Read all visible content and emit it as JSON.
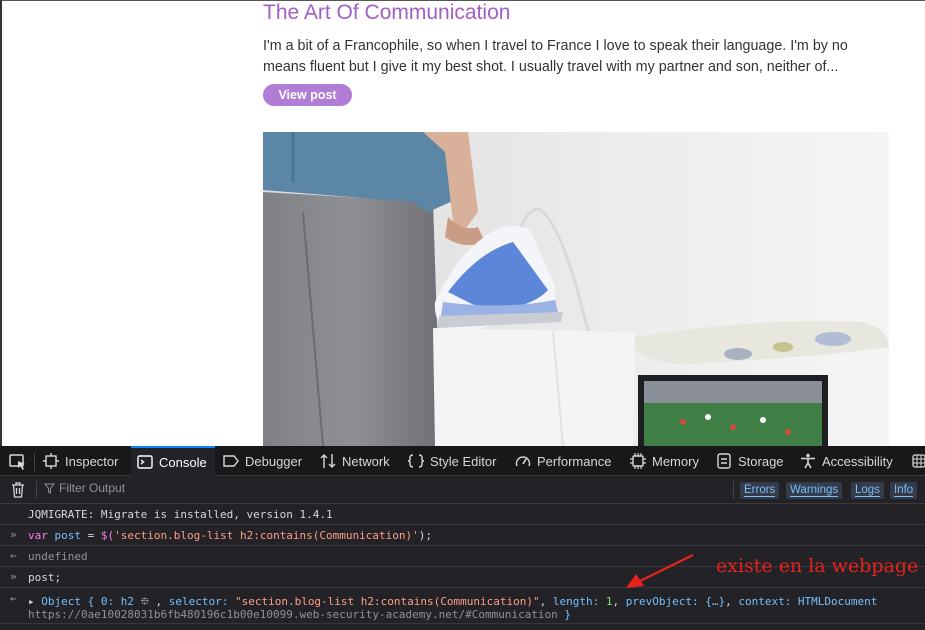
{
  "webpage": {
    "post_title": "The Art Of Communication",
    "post_summary": "I'm a bit of a Francophile, so when I travel to France I love to speak their language. I'm by no means fluent but I give it my best shot. I usually travel with my partner and son, neither of...",
    "view_post_label": "View post"
  },
  "devtools": {
    "tabs": [
      {
        "label": "Inspector",
        "icon": "inspector-icon"
      },
      {
        "label": "Console",
        "icon": "console-icon",
        "active": true
      },
      {
        "label": "Debugger",
        "icon": "debugger-icon"
      },
      {
        "label": "Network",
        "icon": "network-icon"
      },
      {
        "label": "Style Editor",
        "icon": "style-editor-icon"
      },
      {
        "label": "Performance",
        "icon": "performance-icon"
      },
      {
        "label": "Memory",
        "icon": "memory-icon"
      },
      {
        "label": "Storage",
        "icon": "storage-icon"
      },
      {
        "label": "Accessibility",
        "icon": "accessibility-icon"
      }
    ],
    "filter_placeholder": "Filter Output",
    "levels": [
      "Errors",
      "Warnings",
      "Logs",
      "Info"
    ],
    "console": {
      "migrate_msg": "JQMIGRATE: Migrate is installed, version 1.4.1",
      "input1": {
        "kw": "var",
        "name": "post",
        "eq": " = ",
        "fn": "$(",
        "arg": "'section.blog-list h2:contains(Communication)'",
        "end": ");"
      },
      "output1": "undefined",
      "input2": "post;",
      "output2": {
        "obj": "Object { ",
        "key0": "0:",
        "el": " h2",
        "sep1": " , ",
        "k_selector": "selector:",
        "v_selector": " \"section.blog-list h2:contains(Communication)\"",
        "sep2": ", ",
        "k_length": "length:",
        "v_length": " 1",
        "sep3": ", ",
        "k_prev": "prevObject:",
        "v_prev": " {…}",
        "sep4": ", ",
        "k_context": "context:",
        "v_context": " HTMLDocument",
        "url": "https://0ae10028031b6fb480196c1b00e10099.web-security-academy.net/#Communication",
        "close": " }"
      }
    }
  },
  "annotation": "existe en la webpage",
  "colors": {
    "accent": "#a15fc4",
    "button": "#b07cd6",
    "devtools_bg": "#232327",
    "annotation": "#e8221c"
  }
}
